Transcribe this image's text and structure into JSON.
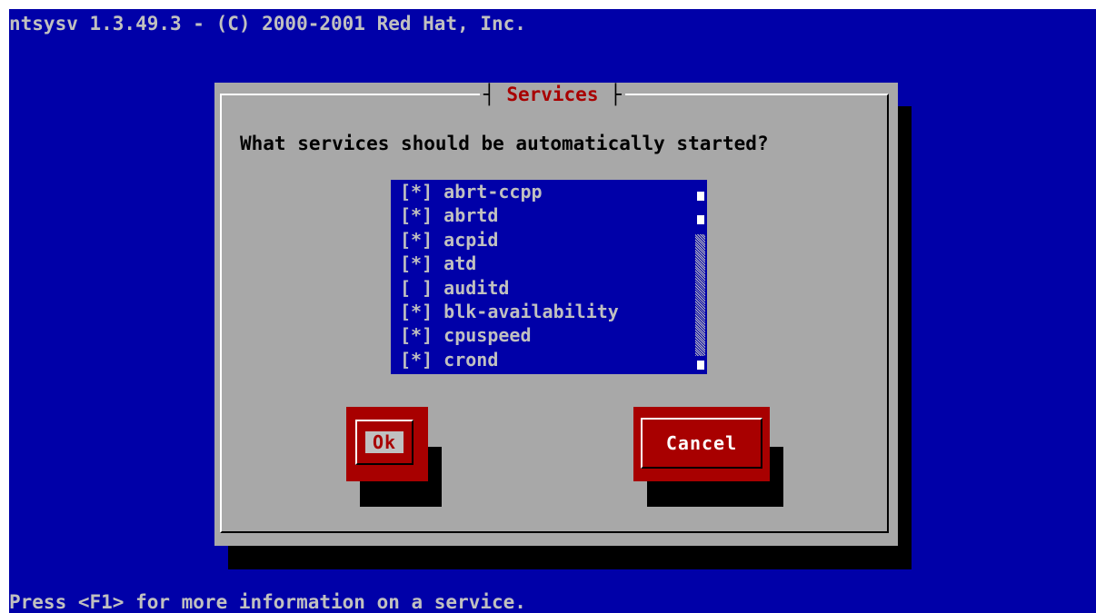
{
  "header": {
    "title": "ntsysv 1.3.49.3 - (C) 2000-2001 Red Hat, Inc."
  },
  "dialog": {
    "title": "Services",
    "prompt": "What services should be automatically started?",
    "services": [
      {
        "mark": "[*]",
        "name": "abrt-ccpp",
        "enabled": true
      },
      {
        "mark": "[*]",
        "name": "abrtd",
        "enabled": true
      },
      {
        "mark": "[*]",
        "name": "acpid",
        "enabled": true
      },
      {
        "mark": "[*]",
        "name": "atd",
        "enabled": true
      },
      {
        "mark": "[ ]",
        "name": "auditd",
        "enabled": false
      },
      {
        "mark": "[*]",
        "name": "blk-availability",
        "enabled": true
      },
      {
        "mark": "[*]",
        "name": "cpuspeed",
        "enabled": true
      },
      {
        "mark": "[*]",
        "name": "crond",
        "enabled": true
      }
    ],
    "buttons": {
      "ok_label": "Ok",
      "cancel_label": "Cancel"
    }
  },
  "footer": {
    "help": "Press <F1> for more information on a service."
  },
  "colors": {
    "background": "#0000a8",
    "dialog": "#a8a8a8",
    "title": "#a80000",
    "button": "#a80000",
    "shadow": "#000000"
  }
}
